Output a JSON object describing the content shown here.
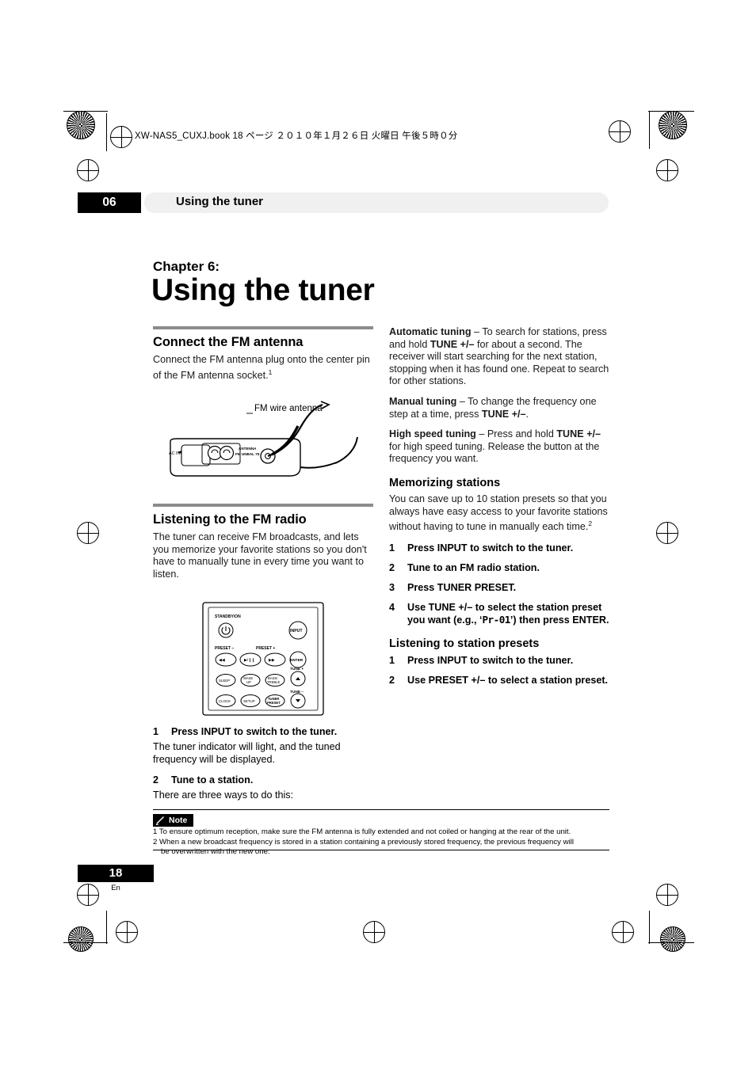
{
  "header": {
    "book_line": "XW-NAS5_CUXJ.book   18 ページ   ２０１０年１月２６日   火曜日   午後５時０分",
    "chapter_number": "06",
    "running_title": "Using the tuner"
  },
  "title": {
    "chapter_label": "Chapter 6:",
    "chapter_title": "Using the tuner"
  },
  "left_column": {
    "section1_heading": "Connect the FM antenna",
    "section1_body_a": "Connect the FM antenna plug onto the center pin of the FM antenna socket.",
    "section1_body_sup": "1",
    "figure1_caption": "FM wire antenna",
    "figure1_labels": {
      "ac_in": "AC IN",
      "antenna": "ANTENNA",
      "fm_unbal": "FM UNBAL 75 Ω"
    },
    "section2_heading": "Listening to the FM radio",
    "section2_body": "The tuner can receive FM broadcasts, and lets you memorize your favorite stations so you don't have to manually tune in every time you want to listen.",
    "figure2_labels": {
      "standby": "STANDBY/ON",
      "input": "INPUT",
      "preset_minus": "PRESET –",
      "preset_plus": "PRESET +",
      "prev": "◀◀",
      "play_pause": "▶/❙❙",
      "next": "▶▶",
      "enter": "ENTER",
      "tune_plus": "TUNE +",
      "tune_minus": "TUNE –",
      "sleep": "SLEEP",
      "wake_up": "WAKE UP",
      "bass_treble": "BASS/ TREBLE",
      "clock": "CLOCK",
      "setup": "SETUP",
      "tuner_preset": "TUNER PRESET"
    },
    "step1_num": "1",
    "step1_text": "Press INPUT to switch to the tuner.",
    "step1_desc": "The tuner indicator will light, and the tuned frequency will be displayed.",
    "step2_num": "2",
    "step2_text": "Tune to a station.",
    "step2_desc": "There are three ways to do this:"
  },
  "right_column": {
    "auto_label": "Automatic tuning",
    "auto_text_a": " – To search for stations, press and hold ",
    "auto_key": "TUNE +/–",
    "auto_text_b": " for about a second. The receiver will start searching for the next station, stopping when it has found one. Repeat to search for other stations.",
    "manual_label": "Manual tuning",
    "manual_text_a": " – To change the frequency one step at a time, press ",
    "manual_key": "TUNE +/–",
    "manual_text_b": ".",
    "high_label": "High speed tuning",
    "high_text_a": " – Press and hold ",
    "high_key": "TUNE +/–",
    "high_text_b": " for high speed tuning. Release the button at the frequency you want.",
    "mem_heading": "Memorizing stations",
    "mem_body": "You can save up to 10 station presets so that you always have easy access to your favorite stations without having to tune in manually each time.",
    "mem_body_sup": "2",
    "mem_step1_num": "1",
    "mem_step1_text": "Press INPUT to switch to the tuner.",
    "mem_step2_num": "2",
    "mem_step2_text": "Tune to an FM radio station.",
    "mem_step3_num": "3",
    "mem_step3_text": "Press TUNER PRESET.",
    "mem_step4_num": "4",
    "mem_step4_text_a": "Use TUNE +/– to select the station preset you want (e.g., ‘",
    "mem_step4_display": "Pr-01",
    "mem_step4_text_b": "’) then press ENTER.",
    "presets_heading": "Listening to station presets",
    "preset_step1_num": "1",
    "preset_step1_text": "Press INPUT to switch to the tuner.",
    "preset_step2_num": "2",
    "preset_step2_text": "Use PRESET +/– to select a station preset."
  },
  "note": {
    "badge": "Note",
    "note1": "1 To ensure optimum reception, make sure the FM antenna is fully extended and not coiled or hanging at the rear of the unit.",
    "note2": "2 When a new broadcast frequency is stored in a station containing a previously stored frequency, the previous frequency will",
    "note2b": "be overwritten with the new one."
  },
  "footer": {
    "page_number": "18",
    "language": "En"
  }
}
